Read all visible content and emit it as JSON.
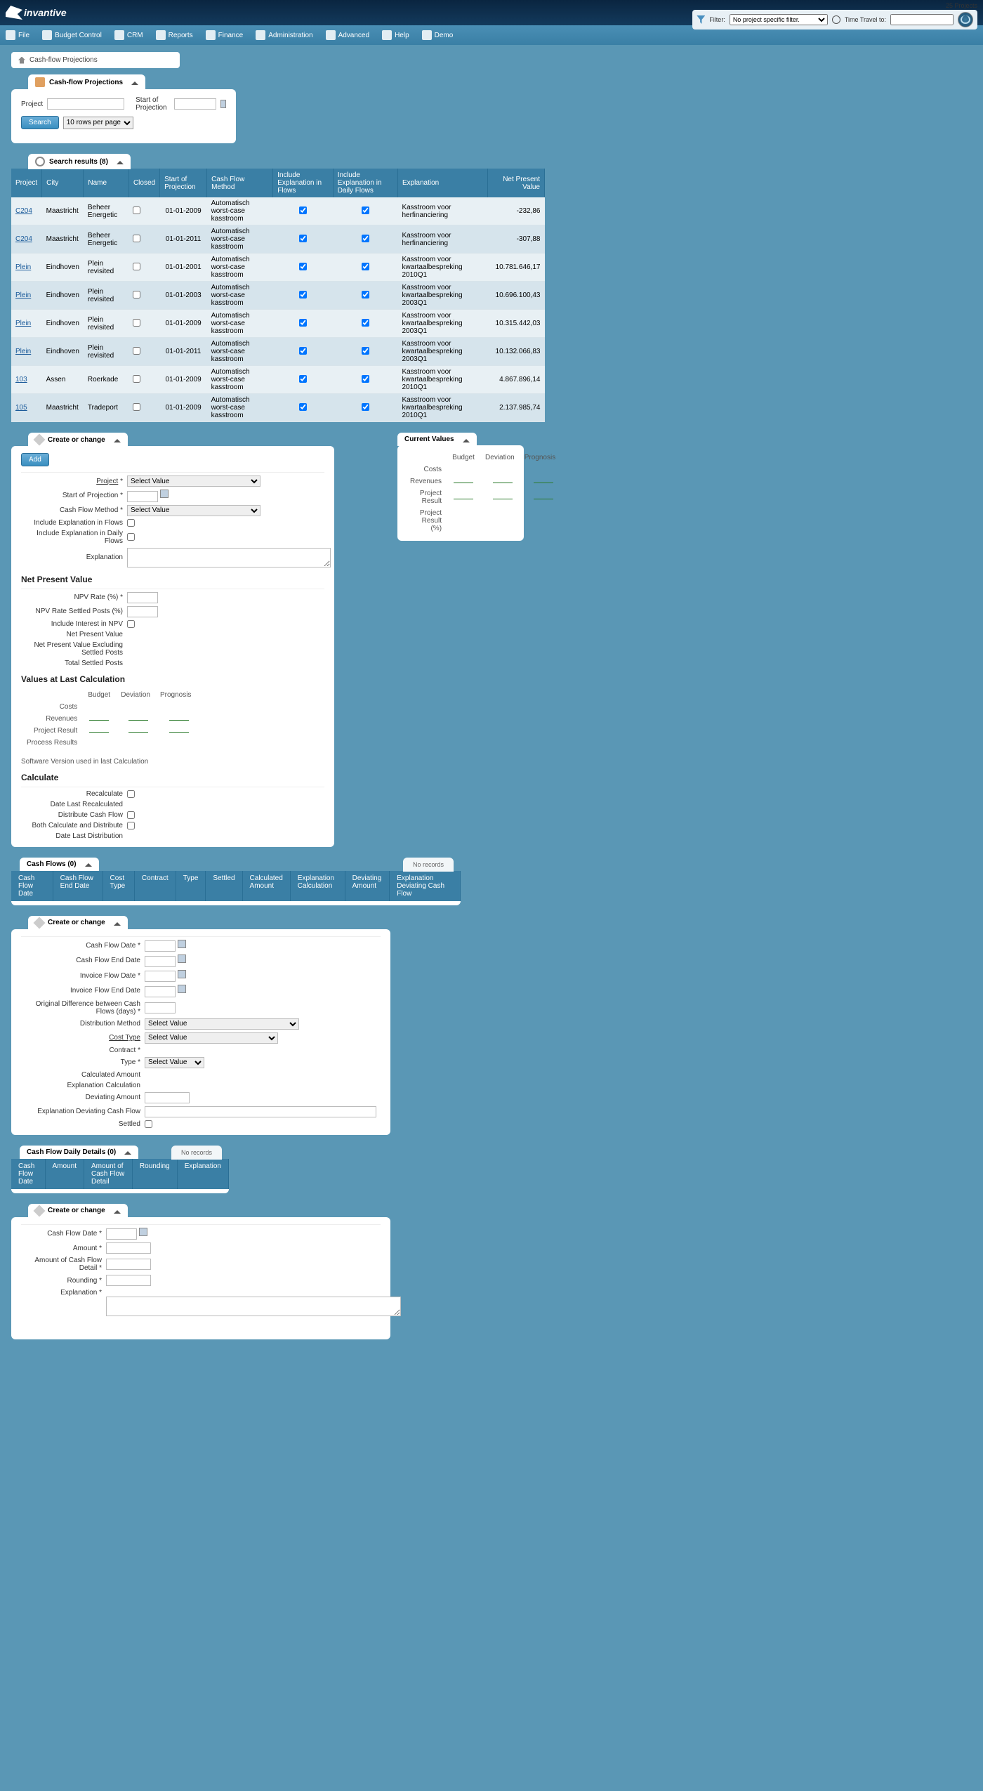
{
  "header": {
    "brand": "invantive",
    "projects_count": "25 Projects",
    "filter_label": "Filter:",
    "filter_value": "No project specific filter.",
    "time_travel": "Time Travel to:"
  },
  "menu": {
    "file": "File",
    "budget": "Budget Control",
    "crm": "CRM",
    "reports": "Reports",
    "finance": "Finance",
    "admin": "Administration",
    "advanced": "Advanced",
    "help": "Help",
    "demo": "Demo"
  },
  "breadcrumb": "Cash-flow Projections",
  "search": {
    "title": "Cash-flow Projections",
    "project": "Project",
    "start": "Start of Projection",
    "btn": "Search",
    "rows": "10 rows per page"
  },
  "results": {
    "title": "Search results (8)",
    "cols": {
      "project": "Project",
      "city": "City",
      "name": "Name",
      "closed": "Closed",
      "start": "Start of Projection",
      "method": "Cash Flow Method",
      "incl_flows": "Include Explanation in Flows",
      "incl_daily": "Include Explanation in Daily Flows",
      "explanation": "Explanation",
      "npv": "Net Present Value"
    },
    "rows": [
      {
        "p": "C204",
        "city": "Maastricht",
        "name": "Beheer Energetic",
        "closed": false,
        "start": "01-01-2009",
        "method": "Automatisch worst-case kasstroom",
        "f": true,
        "d": true,
        "exp": "Kasstroom voor herfinanciering",
        "npv": "-232,86"
      },
      {
        "p": "C204",
        "city": "Maastricht",
        "name": "Beheer Energetic",
        "closed": false,
        "start": "01-01-2011",
        "method": "Automatisch worst-case kasstroom",
        "f": true,
        "d": true,
        "exp": "Kasstroom voor herfinanciering",
        "npv": "-307,88"
      },
      {
        "p": "Plein",
        "city": "Eindhoven",
        "name": "Plein revisited",
        "closed": false,
        "start": "01-01-2001",
        "method": "Automatisch worst-case kasstroom",
        "f": true,
        "d": true,
        "exp": "Kasstroom voor kwartaalbespreking 2010Q1",
        "npv": "10.781.646,17"
      },
      {
        "p": "Plein",
        "city": "Eindhoven",
        "name": "Plein revisited",
        "closed": false,
        "start": "01-01-2003",
        "method": "Automatisch worst-case kasstroom",
        "f": true,
        "d": true,
        "exp": "Kasstroom voor kwartaalbespreking 2003Q1",
        "npv": "10.696.100,43"
      },
      {
        "p": "Plein",
        "city": "Eindhoven",
        "name": "Plein revisited",
        "closed": false,
        "start": "01-01-2009",
        "method": "Automatisch worst-case kasstroom",
        "f": true,
        "d": true,
        "exp": "Kasstroom voor kwartaalbespreking 2003Q1",
        "npv": "10.315.442,03"
      },
      {
        "p": "Plein",
        "city": "Eindhoven",
        "name": "Plein revisited",
        "closed": false,
        "start": "01-01-2011",
        "method": "Automatisch worst-case kasstroom",
        "f": true,
        "d": true,
        "exp": "Kasstroom voor kwartaalbespreking 2003Q1",
        "npv": "10.132.066,83"
      },
      {
        "p": "103",
        "city": "Assen",
        "name": "Roerkade",
        "closed": false,
        "start": "01-01-2009",
        "method": "Automatisch worst-case kasstroom",
        "f": true,
        "d": true,
        "exp": "Kasstroom voor kwartaalbespreking 2010Q1",
        "npv": "4.867.896,14"
      },
      {
        "p": "105",
        "city": "Maastricht",
        "name": "Tradeport",
        "closed": false,
        "start": "01-01-2009",
        "method": "Automatisch worst-case kasstroom",
        "f": true,
        "d": true,
        "exp": "Kasstroom voor kwartaalbespreking 2010Q1",
        "npv": "2.137.985,74"
      }
    ]
  },
  "edit1": {
    "title": "Create or change",
    "add": "Add",
    "project": "Project",
    "req": "*",
    "start": "Start of Projection",
    "method": "Cash Flow Method",
    "incl_flows": "Include Explanation in Flows",
    "incl_daily": "Include Explanation in Daily Flows",
    "explanation": "Explanation",
    "select_value": "Select Value",
    "npv_section": "Net Present Value",
    "npv_rate": "NPV Rate (%)",
    "npv_rate_settled": "NPV Rate Settled Posts (%)",
    "incl_interest": "Include Interest in NPV",
    "npv_label": "Net Present Value",
    "npv_excl": "Net Present Value Excluding Settled Posts",
    "total_settled": "Total Settled Posts",
    "values_section": "Values at Last Calculation",
    "budget": "Budget",
    "deviation": "Deviation",
    "prognosis": "Prognosis",
    "costs": "Costs",
    "revenues": "Revenues",
    "proj_result": "Project Result",
    "proc_results": "Process Results",
    "software_ver": "Software Version used in last Calculation",
    "calc_section": "Calculate",
    "recalc": "Recalculate",
    "date_recalc": "Date Last Recalculated",
    "distribute": "Distribute Cash Flow",
    "both": "Both Calculate and Distribute",
    "date_dist": "Date Last Distribution"
  },
  "current": {
    "title": "Current Values",
    "budget": "Budget",
    "deviation": "Deviation",
    "prognosis": "Prognosis",
    "costs": "Costs",
    "revenues": "Revenues",
    "proj_result": "Project Result",
    "proj_result_pct": "Project Result (%)"
  },
  "cashflows": {
    "title": "Cash Flows (0)",
    "no_records": "No records",
    "cols": {
      "date": "Cash Flow Date",
      "end": "Cash Flow End Date",
      "cost": "Cost Type",
      "contract": "Contract",
      "type": "Type",
      "settled": "Settled",
      "calc": "Calculated Amount",
      "exp_calc": "Explanation Calculation",
      "dev": "Deviating Amount",
      "exp_dev": "Explanation Deviating Cash Flow"
    }
  },
  "edit2": {
    "title": "Create or change",
    "cf_date": "Cash Flow Date",
    "cf_end": "Cash Flow End Date",
    "inv_date": "Invoice Flow Date",
    "inv_end": "Invoice Flow End Date",
    "orig_diff": "Original Difference between Cash Flows (days)",
    "dist_method": "Distribution Method",
    "cost_type": "Cost Type",
    "contract": "Contract",
    "type": "Type",
    "calc_amt": "Calculated Amount",
    "exp_calc": "Explanation Calculation",
    "dev_amt": "Deviating Amount",
    "exp_dev": "Explanation Deviating Cash Flow",
    "settled": "Settled",
    "select_value": "Select Value"
  },
  "daily": {
    "title": "Cash Flow Daily Details (0)",
    "no_records": "No records",
    "cols": {
      "date": "Cash Flow Date",
      "amount": "Amount",
      "amt_detail": "Amount of Cash Flow Detail",
      "rounding": "Rounding",
      "exp": "Explanation"
    }
  },
  "edit3": {
    "title": "Create or change",
    "cf_date": "Cash Flow Date",
    "amount": "Amount",
    "amt_detail": "Amount of Cash Flow Detail",
    "rounding": "Rounding",
    "explanation": "Explanation"
  }
}
